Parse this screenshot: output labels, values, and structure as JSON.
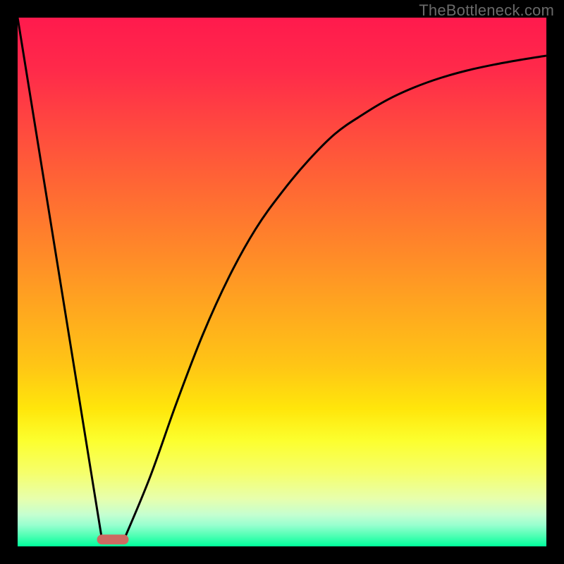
{
  "watermark": "TheBottleneck.com",
  "curve_stroke": "#000000",
  "marker_fill": "#cd6a61",
  "chart_data": {
    "type": "line",
    "title": "",
    "xlabel": "",
    "ylabel": "",
    "xlim": [
      0,
      100
    ],
    "ylim": [
      0,
      100
    ],
    "series": [
      {
        "name": "left-line",
        "x": [
          0,
          16
        ],
        "values": [
          100,
          1
        ]
      },
      {
        "name": "right-curve",
        "x": [
          20,
          25,
          30,
          35,
          40,
          45,
          50,
          55,
          60,
          65,
          70,
          75,
          80,
          85,
          90,
          95,
          100
        ],
        "values": [
          1,
          13,
          27,
          40,
          51,
          60,
          67,
          73,
          78,
          81.5,
          84.5,
          86.8,
          88.6,
          90,
          91.1,
          92,
          92.8
        ]
      }
    ],
    "marker": {
      "x_start": 15,
      "x_end": 21,
      "y": 1.3,
      "rx": 2
    },
    "gradient_stops": [
      {
        "offset": 0.0,
        "color": "#ff1a4d"
      },
      {
        "offset": 0.8,
        "color": "#fcff2e"
      },
      {
        "offset": 0.96,
        "color": "#97ffcf"
      },
      {
        "offset": 1.0,
        "color": "#00ff9c"
      }
    ]
  }
}
